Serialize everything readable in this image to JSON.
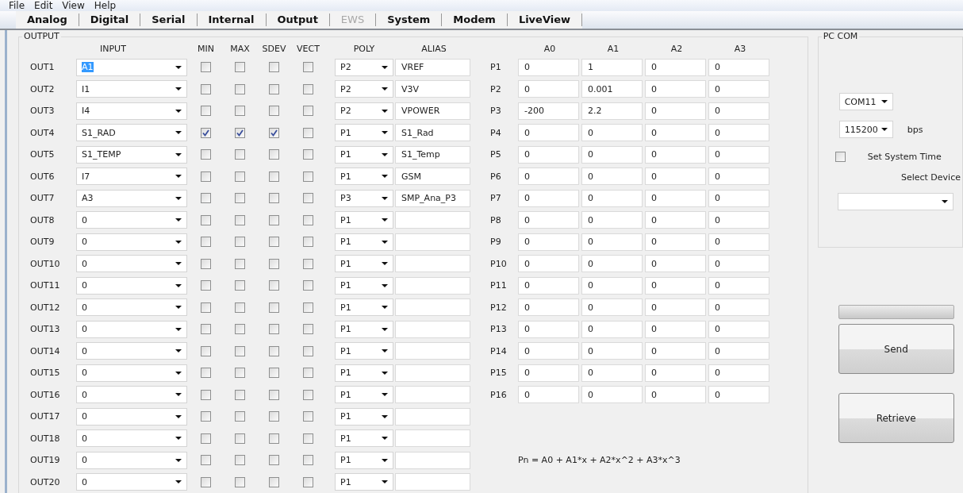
{
  "menu": [
    "File",
    "Edit",
    "View",
    "Help"
  ],
  "tabs": [
    {
      "label": "Analog",
      "disabled": false
    },
    {
      "label": "Digital",
      "disabled": false
    },
    {
      "label": "Serial",
      "disabled": false
    },
    {
      "label": "Internal",
      "disabled": false
    },
    {
      "label": "Output",
      "disabled": false
    },
    {
      "label": "EWS",
      "disabled": true
    },
    {
      "label": "System",
      "disabled": false
    },
    {
      "label": "Modem",
      "disabled": false
    },
    {
      "label": "LiveView",
      "disabled": false
    }
  ],
  "output_group": {
    "title": "OUTPUT",
    "columns": {
      "input": "INPUT",
      "min": "MIN",
      "max": "MAX",
      "sdev": "SDEV",
      "vect": "VECT",
      "poly": "POLY",
      "alias": "ALIAS"
    },
    "coef_columns": [
      "A0",
      "A1",
      "A2",
      "A3"
    ],
    "outputs": [
      {
        "label": "OUT1",
        "input": "A1",
        "input_highlighted": true,
        "min": false,
        "max": false,
        "sdev": false,
        "vect": false,
        "poly": "P2",
        "alias": "VREF"
      },
      {
        "label": "OUT2",
        "input": "I1",
        "input_highlighted": false,
        "min": false,
        "max": false,
        "sdev": false,
        "vect": false,
        "poly": "P2",
        "alias": "V3V"
      },
      {
        "label": "OUT3",
        "input": "I4",
        "input_highlighted": false,
        "min": false,
        "max": false,
        "sdev": false,
        "vect": false,
        "poly": "P2",
        "alias": "VPOWER"
      },
      {
        "label": "OUT4",
        "input": "S1_RAD",
        "input_highlighted": false,
        "min": true,
        "max": true,
        "sdev": true,
        "vect": false,
        "poly": "P1",
        "alias": "S1_Rad"
      },
      {
        "label": "OUT5",
        "input": "S1_TEMP",
        "input_highlighted": false,
        "min": false,
        "max": false,
        "sdev": false,
        "vect": false,
        "poly": "P1",
        "alias": "S1_Temp"
      },
      {
        "label": "OUT6",
        "input": "I7",
        "input_highlighted": false,
        "min": false,
        "max": false,
        "sdev": false,
        "vect": false,
        "poly": "P1",
        "alias": "GSM"
      },
      {
        "label": "OUT7",
        "input": "A3",
        "input_highlighted": false,
        "min": false,
        "max": false,
        "sdev": false,
        "vect": false,
        "poly": "P3",
        "alias": "SMP_Ana_P3"
      },
      {
        "label": "OUT8",
        "input": "0",
        "input_highlighted": false,
        "min": false,
        "max": false,
        "sdev": false,
        "vect": false,
        "poly": "P1"
      },
      {
        "label": "OUT9",
        "input": "0",
        "input_highlighted": false,
        "min": false,
        "max": false,
        "sdev": false,
        "vect": false,
        "poly": "P1"
      },
      {
        "label": "OUT10",
        "input": "0",
        "input_highlighted": false,
        "min": false,
        "max": false,
        "sdev": false,
        "vect": false,
        "poly": "P1"
      },
      {
        "label": "OUT11",
        "input": "0",
        "input_highlighted": false,
        "min": false,
        "max": false,
        "sdev": false,
        "vect": false,
        "poly": "P1"
      },
      {
        "label": "OUT12",
        "input": "0",
        "input_highlighted": false,
        "min": false,
        "max": false,
        "sdev": false,
        "vect": false,
        "poly": "P1"
      },
      {
        "label": "OUT13",
        "input": "0",
        "input_highlighted": false,
        "min": false,
        "max": false,
        "sdev": false,
        "vect": false,
        "poly": "P1"
      },
      {
        "label": "OUT14",
        "input": "0",
        "input_highlighted": false,
        "min": false,
        "max": false,
        "sdev": false,
        "vect": false,
        "poly": "P1"
      },
      {
        "label": "OUT15",
        "input": "0",
        "input_highlighted": false,
        "min": false,
        "max": false,
        "sdev": false,
        "vect": false,
        "poly": "P1"
      },
      {
        "label": "OUT16",
        "input": "0",
        "input_highlighted": false,
        "min": false,
        "max": false,
        "sdev": false,
        "vect": false,
        "poly": "P1"
      },
      {
        "label": "OUT17",
        "input": "0",
        "input_highlighted": false,
        "min": false,
        "max": false,
        "sdev": false,
        "vect": false,
        "poly": "P1"
      },
      {
        "label": "OUT18",
        "input": "0",
        "input_highlighted": false,
        "min": false,
        "max": false,
        "sdev": false,
        "vect": false,
        "poly": "P1"
      },
      {
        "label": "OUT19",
        "input": "0",
        "input_highlighted": false,
        "min": false,
        "max": false,
        "sdev": false,
        "vect": false,
        "poly": "P1"
      },
      {
        "label": "OUT20",
        "input": "0",
        "input_highlighted": false,
        "min": false,
        "max": false,
        "sdev": false,
        "vect": false,
        "poly": "P1"
      }
    ],
    "polynomials": [
      {
        "label": "P1",
        "coefs": [
          "0",
          "1",
          "0",
          "0"
        ]
      },
      {
        "label": "P2",
        "coefs": [
          "0",
          "0.001",
          "0",
          "0"
        ]
      },
      {
        "label": "P3",
        "coefs": [
          "-200",
          "2.2",
          "0",
          "0"
        ]
      },
      {
        "label": "P4",
        "coefs": [
          "0",
          "0",
          "0",
          "0"
        ]
      },
      {
        "label": "P5",
        "coefs": [
          "0",
          "0",
          "0",
          "0"
        ]
      },
      {
        "label": "P6",
        "coefs": [
          "0",
          "0",
          "0",
          "0"
        ]
      },
      {
        "label": "P7",
        "coefs": [
          "0",
          "0",
          "0",
          "0"
        ]
      },
      {
        "label": "P8",
        "coefs": [
          "0",
          "0",
          "0",
          "0"
        ]
      },
      {
        "label": "P9",
        "coefs": [
          "0",
          "0",
          "0",
          "0"
        ]
      },
      {
        "label": "P10",
        "coefs": [
          "0",
          "0",
          "0",
          "0"
        ]
      },
      {
        "label": "P11",
        "coefs": [
          "0",
          "0",
          "0",
          "0"
        ]
      },
      {
        "label": "P12",
        "coefs": [
          "0",
          "0",
          "0",
          "0"
        ]
      },
      {
        "label": "P13",
        "coefs": [
          "0",
          "0",
          "0",
          "0"
        ]
      },
      {
        "label": "P14",
        "coefs": [
          "0",
          "0",
          "0",
          "0"
        ]
      },
      {
        "label": "P15",
        "coefs": [
          "0",
          "0",
          "0",
          "0"
        ]
      },
      {
        "label": "P16",
        "coefs": [
          "0",
          "0",
          "0",
          "0"
        ]
      }
    ],
    "formula": "Pn = A0 + A1*x + A2*x^2 + A3*x^3"
  },
  "pc_com": {
    "title": "PC COM",
    "port": "COM11",
    "baud": "115200",
    "baud_unit": "bps",
    "set_system_time": {
      "label": "Set System Time",
      "checked": false
    },
    "select_device_label": "Select Device"
  },
  "buttons": [
    "Send",
    "Retrieve"
  ]
}
